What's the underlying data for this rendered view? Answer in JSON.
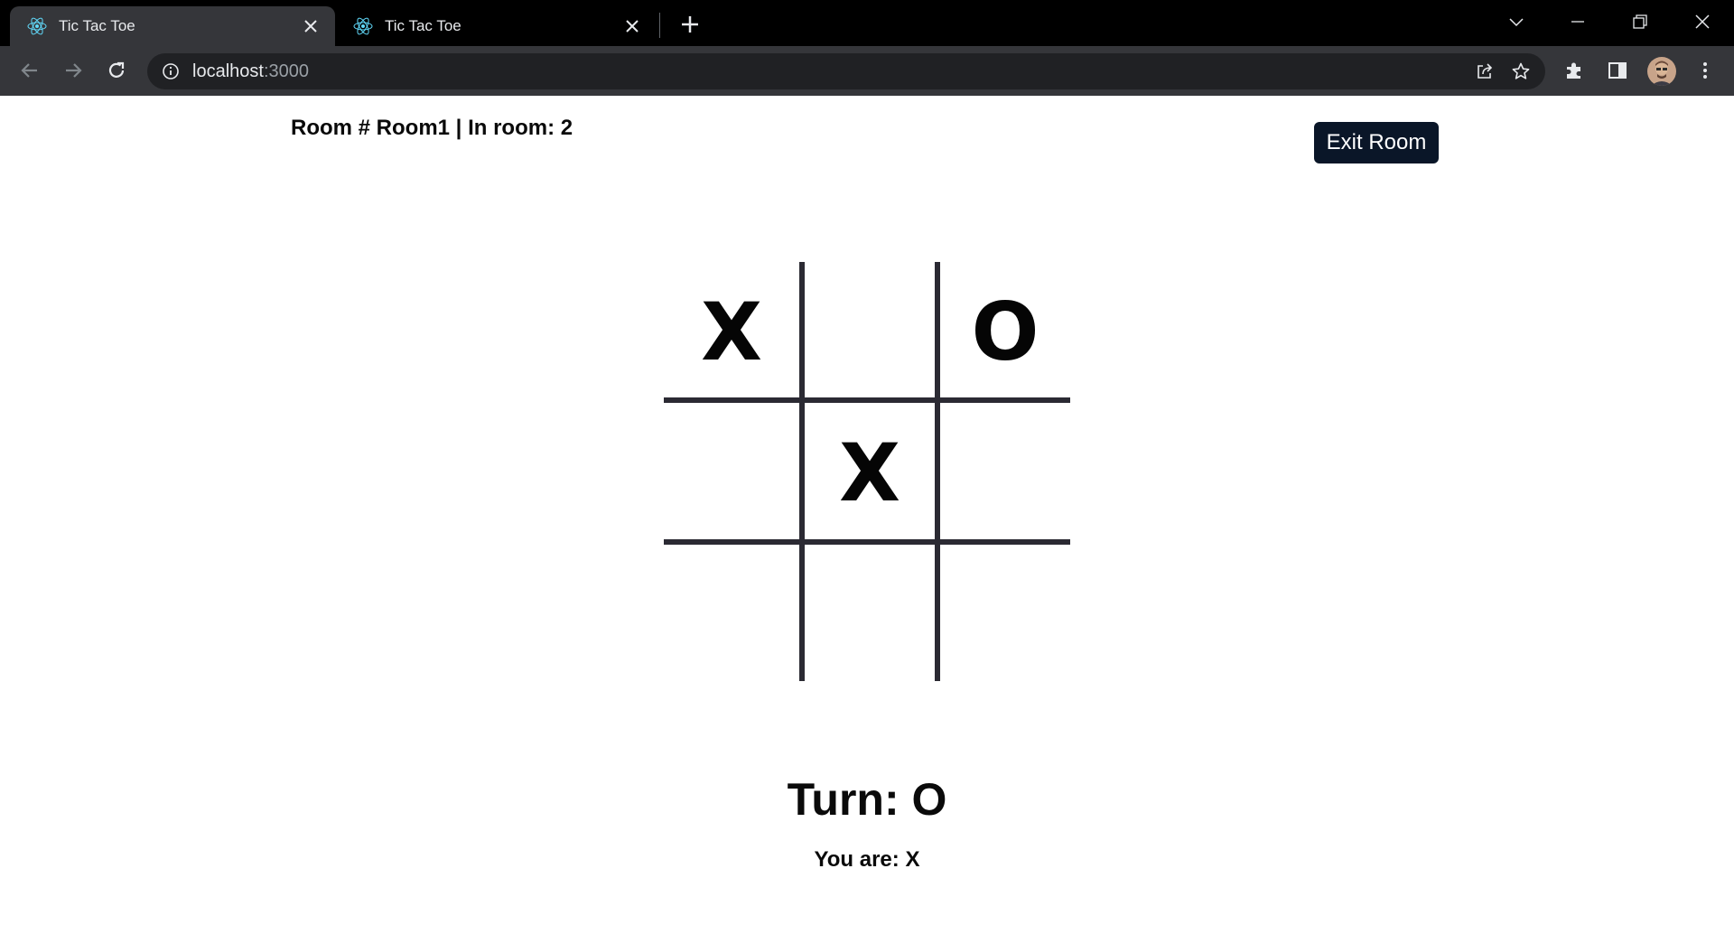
{
  "browser": {
    "tabs": [
      {
        "title": "Tic Tac Toe",
        "active": true
      },
      {
        "title": "Tic Tac Toe",
        "active": false
      }
    ],
    "address": {
      "host": "localhost",
      "port": ":3000"
    },
    "icons": {
      "favicon": "react-icon",
      "back": "arrow-left-icon",
      "forward": "arrow-right-icon",
      "reload": "reload-icon",
      "info": "info-icon",
      "share": "share-icon",
      "bookmark": "star-icon",
      "extensions": "puzzle-icon",
      "sidepanel": "side-panel-icon",
      "menu": "kebab-menu-icon"
    },
    "colors": {
      "tabstrip": "#000000",
      "toolbar": "#35363a",
      "omnibox": "#202124"
    }
  },
  "room": {
    "label": "Room # Room1 | In room: 2",
    "exit_label": "Exit Room"
  },
  "board": {
    "cells": [
      "X",
      "",
      "O",
      "",
      "X",
      "",
      "",
      "",
      ""
    ]
  },
  "status": {
    "turn": "Turn: O",
    "you_are": "You are: X"
  },
  "colors": {
    "exit_button_bg": "#0a1628",
    "grid_lines": "#2b2a33",
    "text": "#0a0a0a"
  }
}
